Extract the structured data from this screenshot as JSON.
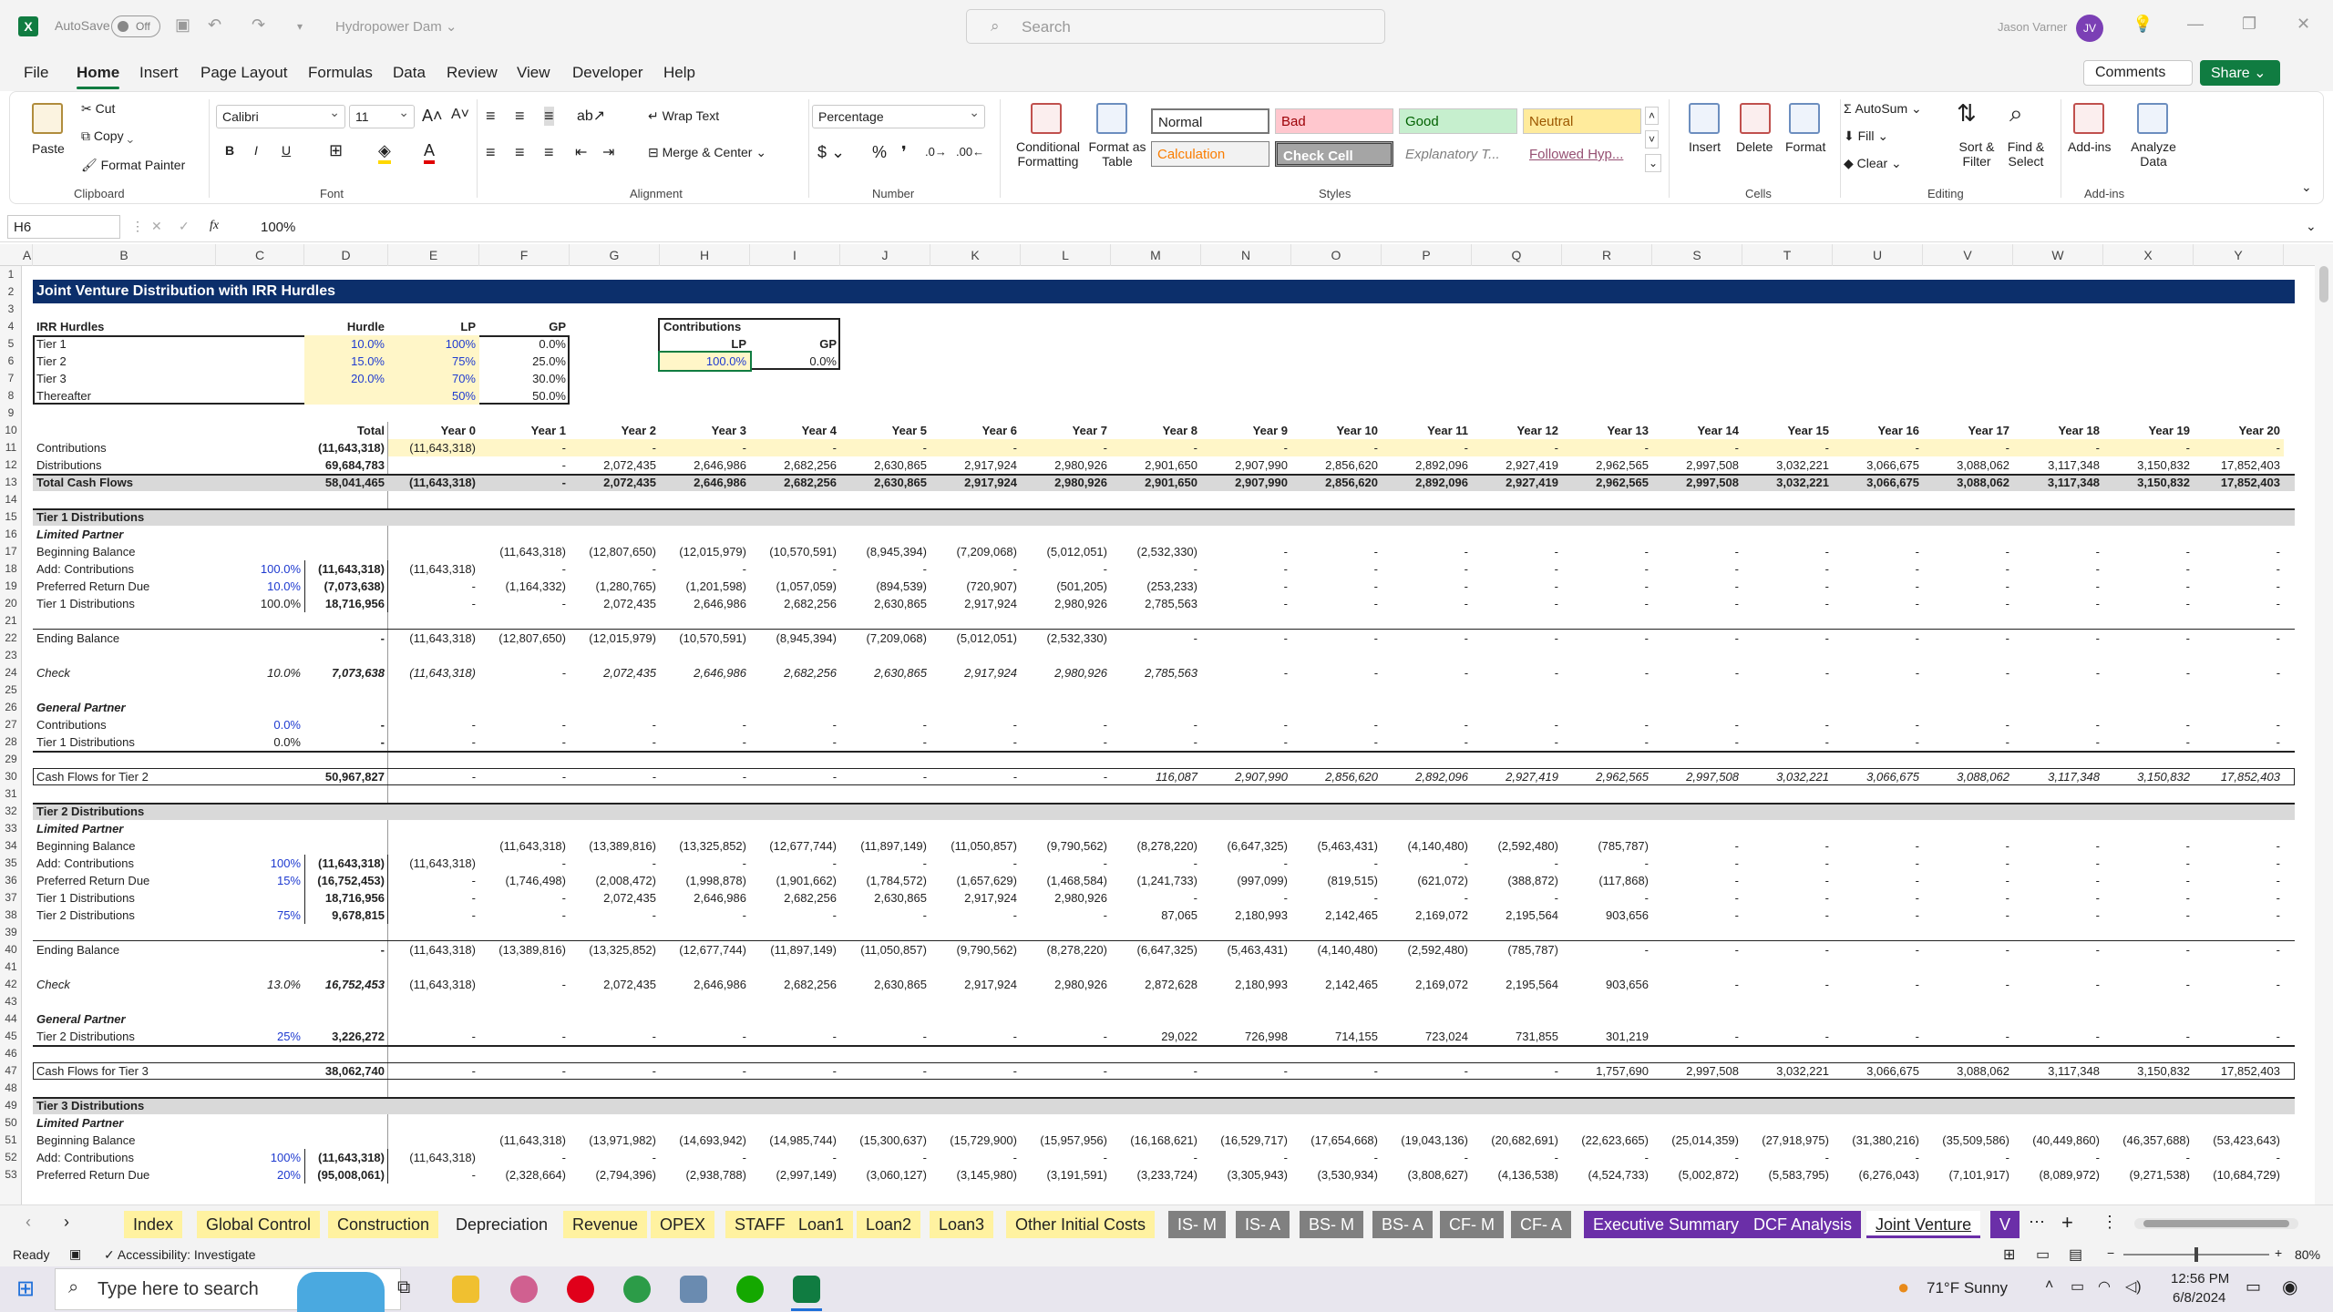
{
  "window": {
    "autosave_label": "AutoSave",
    "autosave_state": "Off",
    "doc_title": "Hydropower Dam ⌄",
    "search_placeholder": "Search",
    "user": "Jason Varner",
    "initials": "JV"
  },
  "menu": [
    "File",
    "Home",
    "Insert",
    "Page Layout",
    "Formulas",
    "Data",
    "Review",
    "View",
    "Developer",
    "Help"
  ],
  "menu_active": "Home",
  "actions": {
    "comments": "Comments",
    "share": "Share ⌄"
  },
  "ribbon": {
    "clipboard": {
      "paste": "Paste",
      "cut": "Cut",
      "copy": "Copy",
      "format_painter": "Format Painter",
      "label": "Clipboard"
    },
    "font": {
      "name": "Calibri",
      "size": "11",
      "label": "Font"
    },
    "alignment": {
      "wrap": "Wrap Text",
      "merge": "Merge & Center",
      "label": "Alignment"
    },
    "number": {
      "format": "Percentage",
      "label": "Number"
    },
    "styles": {
      "conditional": "Conditional Formatting",
      "format_table": "Format as Table",
      "normal": "Normal",
      "bad": "Bad",
      "good": "Good",
      "neutral": "Neutral",
      "calculation": "Calculation",
      "check": "Check Cell",
      "explanatory": "Explanatory T...",
      "followed": "Followed Hyp...",
      "label": "Styles"
    },
    "cells": {
      "insert": "Insert",
      "delete": "Delete",
      "format": "Format",
      "label": "Cells"
    },
    "editing": {
      "autosum": "AutoSum",
      "fill": "Fill",
      "clear": "Clear",
      "sort": "Sort & Filter",
      "find": "Find & Select",
      "label": "Editing"
    },
    "addins": {
      "addins": "Add-ins",
      "analyze": "Analyze Data",
      "label": "Add-ins"
    }
  },
  "formula": {
    "namebox": "H6",
    "fx": "fx",
    "value": "100%"
  },
  "columns": [
    "A",
    "B",
    "C",
    "D",
    "E",
    "F",
    "G",
    "H",
    "I",
    "J",
    "K",
    "L",
    "M",
    "N",
    "O",
    "P",
    "Q",
    "R",
    "S",
    "T",
    "U",
    "V",
    "W",
    "X",
    "Y"
  ],
  "sheet": {
    "title": "Joint Venture Distribution with IRR Hurdles",
    "hurdles_header": [
      "IRR Hurdles",
      "Hurdle",
      "LP",
      "GP"
    ],
    "hurdles": [
      [
        "Tier 1",
        "10.0%",
        "100%",
        "0.0%"
      ],
      [
        "Tier 2",
        "15.0%",
        "75%",
        "25.0%"
      ],
      [
        "Tier 3",
        "20.0%",
        "70%",
        "30.0%"
      ],
      [
        "Thereafter",
        "",
        "50%",
        "50.0%"
      ]
    ],
    "contrib_box": {
      "title": "Contributions",
      "lp": "LP",
      "gp": "GP",
      "lp_val": "100.0%",
      "gp_val": "0.0%"
    },
    "years": [
      "Total",
      "Year 0",
      "Year 1",
      "Year 2",
      "Year 3",
      "Year 4",
      "Year 5",
      "Year 6",
      "Year 7",
      "Year 8",
      "Year 9",
      "Year 10",
      "Year 11",
      "Year 12",
      "Year 13",
      "Year 14",
      "Year 15",
      "Year 16",
      "Year 17",
      "Year 18",
      "Year 19",
      "Year 20"
    ],
    "rows": [
      {
        "r": 11,
        "label": "Contributions",
        "c": "",
        "vals": [
          "(11,643,318)",
          "(11,643,318)",
          "-",
          "-",
          "-",
          "-",
          "-",
          "-",
          "-",
          "-",
          "-",
          "-",
          "-",
          "-",
          "-",
          "-",
          "-",
          "-",
          "-",
          "-",
          "-",
          "-"
        ],
        "style": "yellow"
      },
      {
        "r": 12,
        "label": "Distributions",
        "c": "",
        "vals": [
          "69,684,783",
          "",
          "-",
          "2,072,435",
          "2,646,986",
          "2,682,256",
          "2,630,865",
          "2,917,924",
          "2,980,926",
          "2,901,650",
          "2,907,990",
          "2,856,620",
          "2,892,096",
          "2,927,419",
          "2,962,565",
          "2,997,508",
          "3,032,221",
          "3,066,675",
          "3,088,062",
          "3,117,348",
          "3,150,832",
          "17,852,403"
        ],
        "style": "yellow"
      },
      {
        "r": 13,
        "label": "Total Cash Flows",
        "c": "",
        "vals": [
          "58,041,465",
          "(11,643,318)",
          "-",
          "2,072,435",
          "2,646,986",
          "2,682,256",
          "2,630,865",
          "2,917,924",
          "2,980,926",
          "2,901,650",
          "2,907,990",
          "2,856,620",
          "2,892,096",
          "2,927,419",
          "2,962,565",
          "2,997,508",
          "3,032,221",
          "3,066,675",
          "3,088,062",
          "3,117,348",
          "3,150,832",
          "17,852,403"
        ],
        "style": "grey"
      },
      {
        "r": 15,
        "label": "Tier 1 Distributions",
        "c": "",
        "vals": [],
        "style": "grey"
      },
      {
        "r": 16,
        "label": "Limited Partner",
        "c": "",
        "vals": [],
        "style": "bi"
      },
      {
        "r": 17,
        "label": "Beginning Balance",
        "c": "",
        "vals": [
          "",
          "",
          "(11,643,318)",
          "(12,807,650)",
          "(12,015,979)",
          "(10,570,591)",
          "(8,945,394)",
          "(7,209,068)",
          "(5,012,051)",
          "(2,532,330)",
          "-",
          "-",
          "-",
          "-",
          "-",
          "-",
          "-",
          "-",
          "-",
          "-",
          "-",
          "-"
        ]
      },
      {
        "r": 18,
        "label": "Add: Contributions",
        "c": "100.0%",
        "vals": [
          "(11,643,318)",
          "(11,643,318)",
          "-",
          "-",
          "-",
          "-",
          "-",
          "-",
          "-",
          "-",
          "-",
          "-",
          "-",
          "-",
          "-",
          "-",
          "-",
          "-",
          "-",
          "-",
          "-",
          "-"
        ]
      },
      {
        "r": 19,
        "label": "Preferred Return Due",
        "c": "10.0%",
        "vals": [
          "(7,073,638)",
          "-",
          "(1,164,332)",
          "(1,280,765)",
          "(1,201,598)",
          "(1,057,059)",
          "(894,539)",
          "(720,907)",
          "(501,205)",
          "(253,233)",
          "-",
          "-",
          "-",
          "-",
          "-",
          "-",
          "-",
          "-",
          "-",
          "-",
          "-",
          "-"
        ]
      },
      {
        "r": 20,
        "label": "Tier 1 Distributions",
        "c": "100.0%",
        "vals": [
          "18,716,956",
          "-",
          "-",
          "2,072,435",
          "2,646,986",
          "2,682,256",
          "2,630,865",
          "2,917,924",
          "2,980,926",
          "2,785,563",
          "-",
          "-",
          "-",
          "-",
          "-",
          "-",
          "-",
          "-",
          "-",
          "-",
          "-",
          "-"
        ]
      },
      {
        "r": 22,
        "label": "Ending Balance",
        "c": "",
        "vals": [
          "-",
          "(11,643,318)",
          "(12,807,650)",
          "(12,015,979)",
          "(10,570,591)",
          "(8,945,394)",
          "(7,209,068)",
          "(5,012,051)",
          "(2,532,330)",
          "-",
          "-",
          "-",
          "-",
          "-",
          "-",
          "-",
          "-",
          "-",
          "-",
          "-",
          "-",
          "-"
        ],
        "style": "topline"
      },
      {
        "r": 24,
        "label": "Check",
        "c": "10.0%",
        "vals": [
          "7,073,638",
          "(11,643,318)",
          "-",
          "2,072,435",
          "2,646,986",
          "2,682,256",
          "2,630,865",
          "2,917,924",
          "2,980,926",
          "2,785,563",
          "-",
          "-",
          "-",
          "-",
          "-",
          "-",
          "-",
          "-",
          "-",
          "-",
          "-",
          "-"
        ],
        "style": "italic"
      },
      {
        "r": 26,
        "label": "General Partner",
        "c": "",
        "vals": [],
        "style": "bi"
      },
      {
        "r": 27,
        "label": "Contributions",
        "c": "0.0%",
        "vals": [
          "-",
          "-",
          "-",
          "-",
          "-",
          "-",
          "-",
          "-",
          "-",
          "-",
          "-",
          "-",
          "-",
          "-",
          "-",
          "-",
          "-",
          "-",
          "-",
          "-",
          "-",
          "-"
        ]
      },
      {
        "r": 28,
        "label": "Tier 1 Distributions",
        "c": "0.0%",
        "vals": [
          "-",
          "-",
          "-",
          "-",
          "-",
          "-",
          "-",
          "-",
          "-",
          "-",
          "-",
          "-",
          "-",
          "-",
          "-",
          "-",
          "-",
          "-",
          "-",
          "-",
          "-",
          "-"
        ],
        "style": "bottomline"
      },
      {
        "r": 30,
        "label": "Cash Flows for Tier 2",
        "c": "",
        "vals": [
          "50,967,827",
          "-",
          "-",
          "-",
          "-",
          "-",
          "-",
          "-",
          "-",
          "116,087",
          "2,907,990",
          "2,856,620",
          "2,892,096",
          "2,927,419",
          "2,962,565",
          "2,997,508",
          "3,032,221",
          "3,066,675",
          "3,088,062",
          "3,117,348",
          "3,150,832",
          "17,852,403"
        ],
        "style": "boxed"
      },
      {
        "r": 32,
        "label": "Tier 2 Distributions",
        "c": "",
        "vals": [],
        "style": "grey"
      },
      {
        "r": 33,
        "label": "Limited Partner",
        "c": "",
        "vals": [],
        "style": "bi"
      },
      {
        "r": 34,
        "label": "Beginning Balance",
        "c": "",
        "vals": [
          "",
          "",
          "(11,643,318)",
          "(13,389,816)",
          "(13,325,852)",
          "(12,677,744)",
          "(11,897,149)",
          "(11,050,857)",
          "(9,790,562)",
          "(8,278,220)",
          "(6,647,325)",
          "(5,463,431)",
          "(4,140,480)",
          "(2,592,480)",
          "(785,787)",
          "-",
          "-",
          "-",
          "-",
          "-",
          "-",
          "-"
        ]
      },
      {
        "r": 35,
        "label": "Add: Contributions",
        "c": "100%",
        "vals": [
          "(11,643,318)",
          "(11,643,318)",
          "-",
          "-",
          "-",
          "-",
          "-",
          "-",
          "-",
          "-",
          "-",
          "-",
          "-",
          "-",
          "-",
          "-",
          "-",
          "-",
          "-",
          "-",
          "-",
          "-"
        ]
      },
      {
        "r": 36,
        "label": "Preferred Return Due",
        "c": "15%",
        "vals": [
          "(16,752,453)",
          "-",
          "(1,746,498)",
          "(2,008,472)",
          "(1,998,878)",
          "(1,901,662)",
          "(1,784,572)",
          "(1,657,629)",
          "(1,468,584)",
          "(1,241,733)",
          "(997,099)",
          "(819,515)",
          "(621,072)",
          "(388,872)",
          "(117,868)",
          "-",
          "-",
          "-",
          "-",
          "-",
          "-",
          "-"
        ]
      },
      {
        "r": 37,
        "label": "Tier 1 Distributions",
        "c": "",
        "vals": [
          "18,716,956",
          "-",
          "-",
          "2,072,435",
          "2,646,986",
          "2,682,256",
          "2,630,865",
          "2,917,924",
          "2,980,926",
          "-",
          "-",
          "-",
          "-",
          "-",
          "-",
          "-",
          "-",
          "-",
          "-",
          "-",
          "-",
          "-"
        ]
      },
      {
        "r": 38,
        "label": "Tier 2 Distributions",
        "c": "75%",
        "vals": [
          "9,678,815",
          "-",
          "-",
          "-",
          "-",
          "-",
          "-",
          "-",
          "-",
          "87,065",
          "2,180,993",
          "2,142,465",
          "2,169,072",
          "2,195,564",
          "903,656",
          "-",
          "-",
          "-",
          "-",
          "-",
          "-",
          "-"
        ]
      },
      {
        "r": 40,
        "label": "Ending Balance",
        "c": "",
        "vals": [
          "-",
          "(11,643,318)",
          "(13,389,816)",
          "(13,325,852)",
          "(12,677,744)",
          "(11,897,149)",
          "(11,050,857)",
          "(9,790,562)",
          "(8,278,220)",
          "(6,647,325)",
          "(5,463,431)",
          "(4,140,480)",
          "(2,592,480)",
          "(785,787)",
          "-",
          "-",
          "-",
          "-",
          "-",
          "-",
          "-",
          "-"
        ],
        "style": "topline"
      },
      {
        "r": 42,
        "label": "Check",
        "c": "13.0%",
        "vals": [
          "16,752,453",
          "(11,643,318)",
          "-",
          "2,072,435",
          "2,646,986",
          "2,682,256",
          "2,630,865",
          "2,917,924",
          "2,980,926",
          "2,872,628",
          "2,180,993",
          "2,142,465",
          "2,169,072",
          "2,195,564",
          "903,656",
          "-",
          "-",
          "-",
          "-",
          "-",
          "-",
          "-"
        ],
        "style": "italicc"
      },
      {
        "r": 44,
        "label": "General Partner",
        "c": "",
        "vals": [],
        "style": "bi"
      },
      {
        "r": 45,
        "label": "Tier 2 Distributions",
        "c": "25%",
        "vals": [
          "3,226,272",
          "-",
          "-",
          "-",
          "-",
          "-",
          "-",
          "-",
          "-",
          "29,022",
          "726,998",
          "714,155",
          "723,024",
          "731,855",
          "301,219",
          "-",
          "-",
          "-",
          "-",
          "-",
          "-",
          "-"
        ],
        "style": "bottomline"
      },
      {
        "r": 47,
        "label": "Cash Flows for Tier 3",
        "c": "",
        "vals": [
          "38,062,740",
          "-",
          "-",
          "-",
          "-",
          "-",
          "-",
          "-",
          "-",
          "-",
          "-",
          "-",
          "-",
          "-",
          "1,757,690",
          "2,997,508",
          "3,032,221",
          "3,066,675",
          "3,088,062",
          "3,117,348",
          "3,150,832",
          "17,852,403"
        ],
        "style": "boxedplain"
      },
      {
        "r": 49,
        "label": "Tier 3 Distributions",
        "c": "",
        "vals": [],
        "style": "grey"
      },
      {
        "r": 50,
        "label": "Limited Partner",
        "c": "",
        "vals": [],
        "style": "bi"
      },
      {
        "r": 51,
        "label": "Beginning Balance",
        "c": "",
        "vals": [
          "",
          "",
          "(11,643,318)",
          "(13,971,982)",
          "(14,693,942)",
          "(14,985,744)",
          "(15,300,637)",
          "(15,729,900)",
          "(15,957,956)",
          "(16,168,621)",
          "(16,529,717)",
          "(17,654,668)",
          "(19,043,136)",
          "(20,682,691)",
          "(22,623,665)",
          "(25,014,359)",
          "(27,918,975)",
          "(31,380,216)",
          "(35,509,586)",
          "(40,449,860)",
          "(46,357,688)",
          "(53,423,643)"
        ]
      },
      {
        "r": 52,
        "label": "Add: Contributions",
        "c": "100%",
        "vals": [
          "(11,643,318)",
          "(11,643,318)",
          "-",
          "-",
          "-",
          "-",
          "-",
          "-",
          "-",
          "-",
          "-",
          "-",
          "-",
          "-",
          "-",
          "-",
          "-",
          "-",
          "-",
          "-",
          "-",
          "-"
        ]
      },
      {
        "r": 53,
        "label": "Preferred Return Due",
        "c": "20%",
        "vals": [
          "(95,008,061)",
          "-",
          "(2,328,664)",
          "(2,794,396)",
          "(2,938,788)",
          "(2,997,149)",
          "(3,060,127)",
          "(3,145,980)",
          "(3,191,591)",
          "(3,233,724)",
          "(3,305,943)",
          "(3,530,934)",
          "(3,808,627)",
          "(4,136,538)",
          "(4,524,733)",
          "(5,002,872)",
          "(5,583,795)",
          "(6,276,043)",
          "(7,101,917)",
          "(8,089,972)",
          "(9,271,538)",
          "(10,684,729)"
        ]
      }
    ]
  },
  "tabs": [
    {
      "label": "Index",
      "kind": "y"
    },
    {
      "label": "Global Control",
      "kind": "y"
    },
    {
      "label": "Construction",
      "kind": "y"
    },
    {
      "label": "Depreciation",
      "kind": "w"
    },
    {
      "label": "Revenue",
      "kind": "y"
    },
    {
      "label": "OPEX",
      "kind": "y"
    },
    {
      "label": "STAFF",
      "kind": "y"
    },
    {
      "label": "Loan1",
      "kind": "y"
    },
    {
      "label": "Loan2",
      "kind": "y"
    },
    {
      "label": "Loan3",
      "kind": "y"
    },
    {
      "label": "Other Initial Costs",
      "kind": "y"
    },
    {
      "label": "IS- M",
      "kind": "g"
    },
    {
      "label": "IS- A",
      "kind": "g"
    },
    {
      "label": "BS- M",
      "kind": "g"
    },
    {
      "label": "BS- A",
      "kind": "g"
    },
    {
      "label": "CF- M",
      "kind": "g"
    },
    {
      "label": "CF- A",
      "kind": "g"
    },
    {
      "label": "Executive Summary",
      "kind": "p"
    },
    {
      "label": "DCF Analysis",
      "kind": "p"
    },
    {
      "label": "Joint Venture",
      "kind": "active"
    },
    {
      "label": "V",
      "kind": "p"
    }
  ],
  "status": {
    "ready": "Ready",
    "accessibility": "Accessibility: Investigate",
    "zoom": "80%"
  },
  "taskbar": {
    "search": "Type here to search",
    "weather": "71°F  Sunny",
    "time": "12:56 PM",
    "date": "6/8/2024"
  }
}
